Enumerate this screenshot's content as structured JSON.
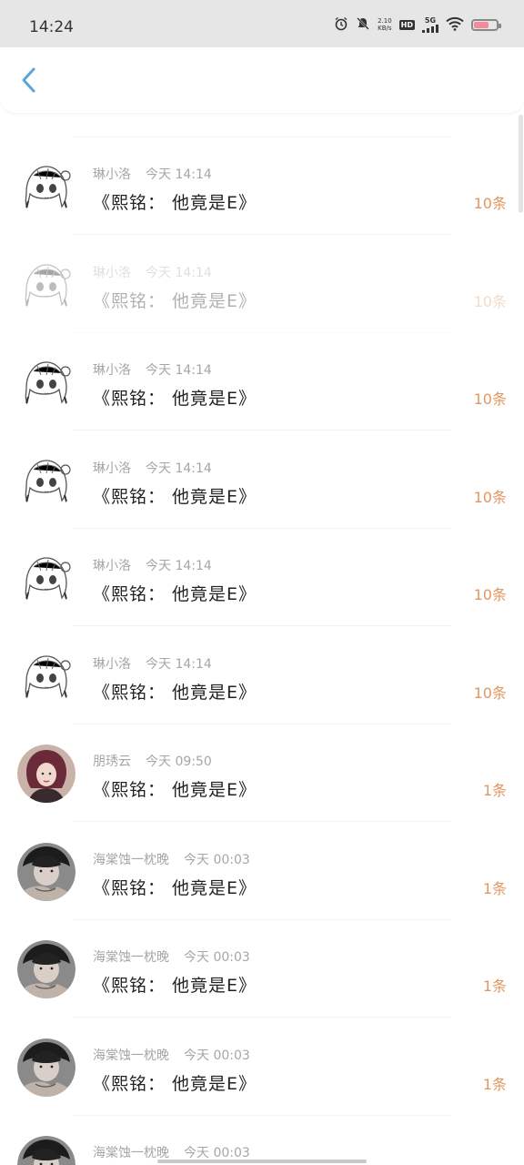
{
  "status_bar": {
    "time": "14:24",
    "net_speed_value": "2.10",
    "net_speed_unit": "KB/s",
    "hd_label": "HD",
    "network_label": "5G"
  },
  "colors": {
    "accent_back": "#5aa5dc",
    "count_orange": "#e29660",
    "meta_gray": "#a6a6a6"
  },
  "messages": [
    {
      "user": "琳小洛",
      "time": "今天 14:14",
      "title": "《熙铭： 他竟是E》",
      "count": "10条",
      "avatar": "anime-girl-avatar",
      "faded": false
    },
    {
      "user": "琳小洛",
      "time": "今天 14:14",
      "title": "《熙铭： 他竟是E》",
      "count": "10条",
      "avatar": "anime-girl-avatar",
      "faded": true
    },
    {
      "user": "琳小洛",
      "time": "今天 14:14",
      "title": "《熙铭： 他竟是E》",
      "count": "10条",
      "avatar": "anime-girl-avatar",
      "faded": false
    },
    {
      "user": "琳小洛",
      "time": "今天 14:14",
      "title": "《熙铭： 他竟是E》",
      "count": "10条",
      "avatar": "anime-girl-avatar",
      "faded": false
    },
    {
      "user": "琳小洛",
      "time": "今天 14:14",
      "title": "《熙铭： 他竟是E》",
      "count": "10条",
      "avatar": "anime-girl-avatar",
      "faded": false
    },
    {
      "user": "琳小洛",
      "time": "今天 14:14",
      "title": "《熙铭： 他竟是E》",
      "count": "10条",
      "avatar": "anime-girl-avatar",
      "faded": false
    },
    {
      "user": "朋琇云",
      "time": "今天 09:50",
      "title": "《熙铭： 他竟是E》",
      "count": "1条",
      "avatar": "woman-photo-avatar",
      "faded": false
    },
    {
      "user": "海棠蚀一枕晚",
      "time": "今天 00:03",
      "title": "《熙铭： 他竟是E》",
      "count": "1条",
      "avatar": "boy-photo-avatar",
      "faded": false
    },
    {
      "user": "海棠蚀一枕晚",
      "time": "今天 00:03",
      "title": "《熙铭： 他竟是E》",
      "count": "1条",
      "avatar": "boy-photo-avatar",
      "faded": false
    },
    {
      "user": "海棠蚀一枕晚",
      "time": "今天 00:03",
      "title": "《熙铭： 他竟是E》",
      "count": "1条",
      "avatar": "boy-photo-avatar",
      "faded": false
    },
    {
      "user": "海棠蚀一枕晚",
      "time": "今天 00:03",
      "title": "",
      "count": "",
      "avatar": "boy-photo-avatar",
      "faded": false
    }
  ]
}
